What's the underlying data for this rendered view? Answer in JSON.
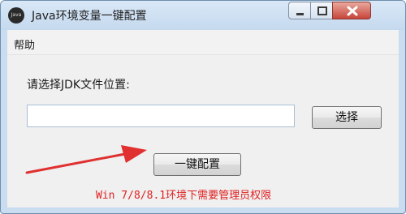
{
  "window": {
    "title": "Java环境变量一键配置",
    "icon_text": "Java"
  },
  "menu": {
    "items": [
      {
        "label": "帮助"
      }
    ]
  },
  "main": {
    "jdk_label": "请选择JDK文件位置:",
    "jdk_path_value": "",
    "select_button": "选择",
    "config_button": "一键配置",
    "note": "Win 7/8/8.1环境下需要管理员权限"
  },
  "colors": {
    "note": "#e02020",
    "arrow": "#e03030",
    "titlebar": "#c9dcf0",
    "close_button": "#c7443a"
  }
}
